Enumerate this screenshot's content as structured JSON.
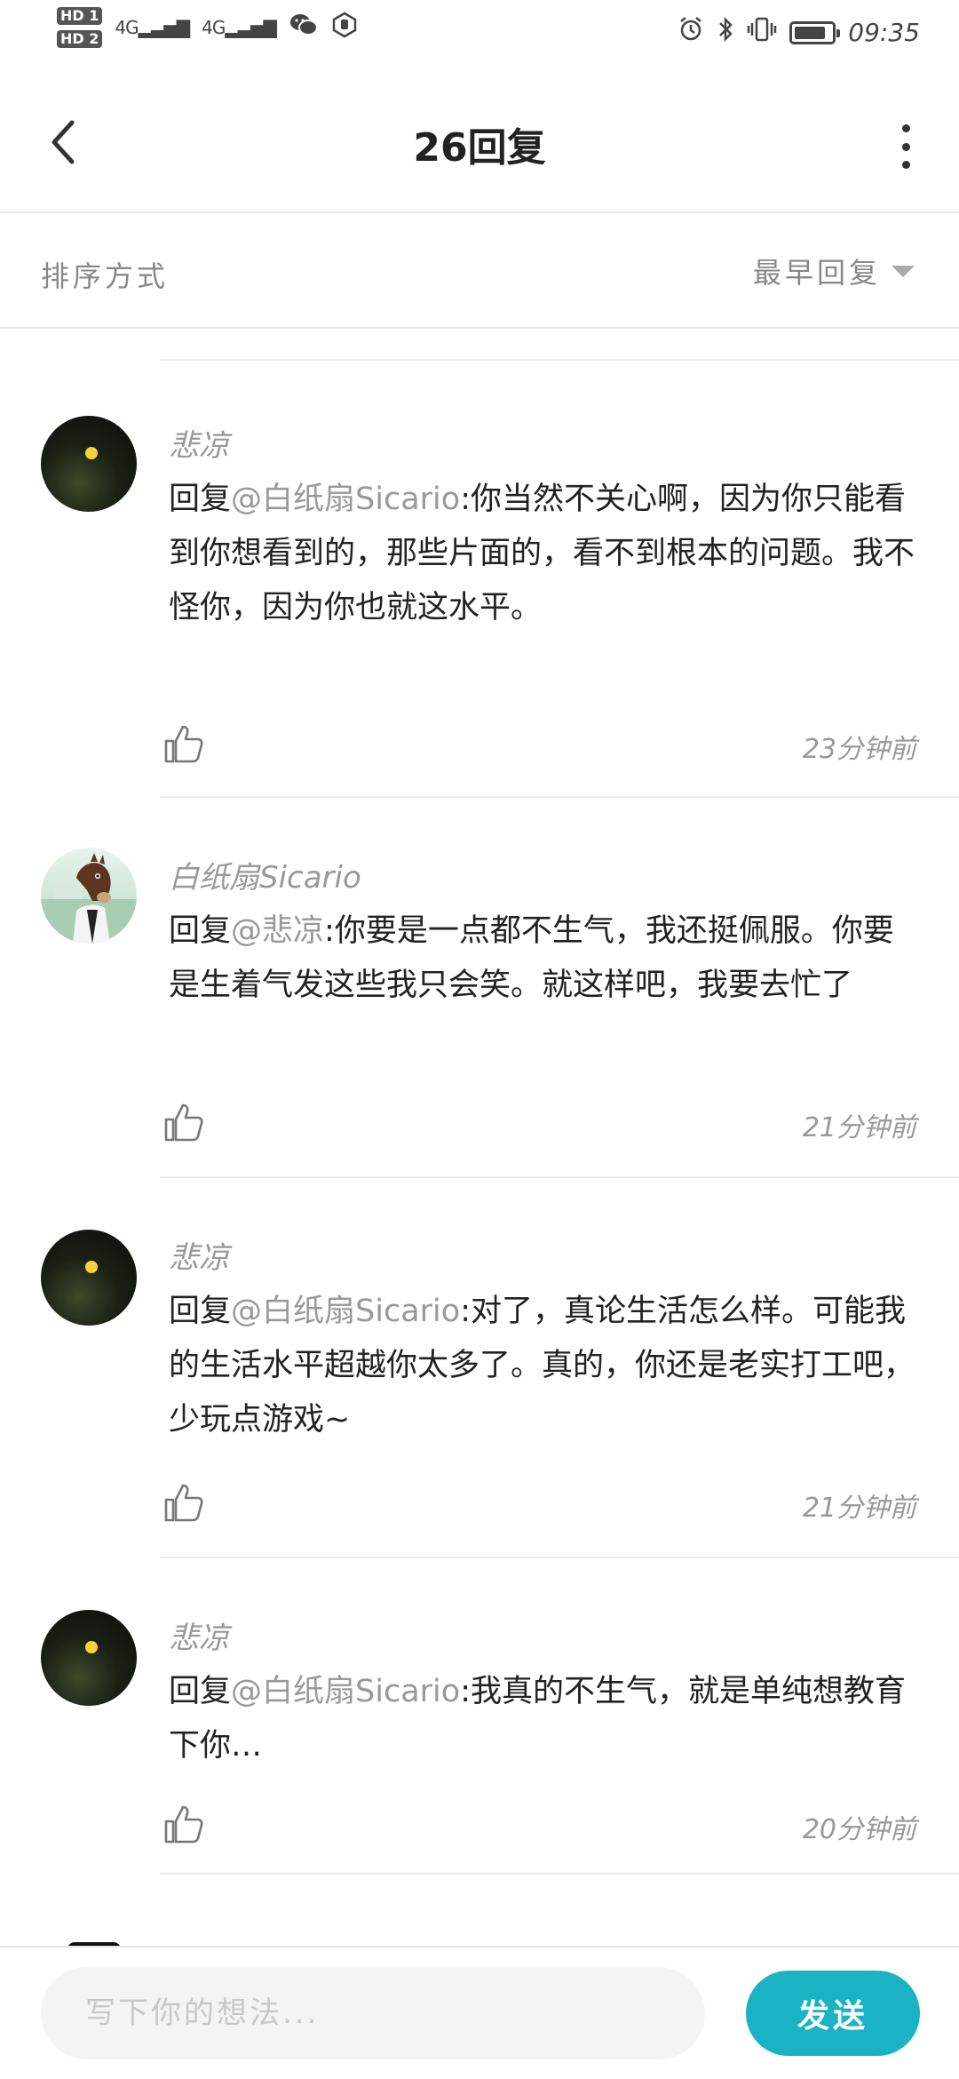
{
  "status_bar": {
    "hd1": "HD 1",
    "hd2": "HD 2",
    "signal1": "4G",
    "signal2": "4G",
    "time": "09:35",
    "icons": [
      "wechat-icon",
      "hand-icon",
      "alarm-icon",
      "bluetooth-icon",
      "vibrate-icon",
      "battery-icon"
    ]
  },
  "nav": {
    "title": "26回复"
  },
  "sort": {
    "label": "排序方式",
    "value": "最早回复"
  },
  "comments": [
    {
      "author": "悲凉",
      "prefix": "回复",
      "mention": "@白纸扇Sicario",
      "text": ":你当然不关心啊，因为你只能看到你想看到的，那些片面的，看不到根本的问题。我不怪你，因为你也就这水平。",
      "time": "23分钟前"
    },
    {
      "author": "白纸扇Sicario",
      "prefix": "回复",
      "mention": "@悲凉",
      "text": ":你要是一点都不生气，我还挺佩服。你要是生着气发这些我只会笑。就这样吧，我要去忙了",
      "time": "21分钟前"
    },
    {
      "author": "悲凉",
      "prefix": "回复",
      "mention": "@白纸扇Sicario",
      "text": ":对了，真论生活怎么样。可能我的生活水平超越你太多了。真的，你还是老实打工吧，少玩点游戏~",
      "time": "21分钟前"
    },
    {
      "author": "悲凉",
      "prefix": "回复",
      "mention": "@白纸扇Sicario",
      "text": ":我真的不生气，就是单纯想教育下你…",
      "time": "20分钟前"
    }
  ],
  "composer": {
    "placeholder": "写下你的想法...",
    "send_label": "发送"
  },
  "colors": {
    "accent": "#1ab3c3",
    "muted_text": "#999999",
    "divider": "#ececec"
  }
}
